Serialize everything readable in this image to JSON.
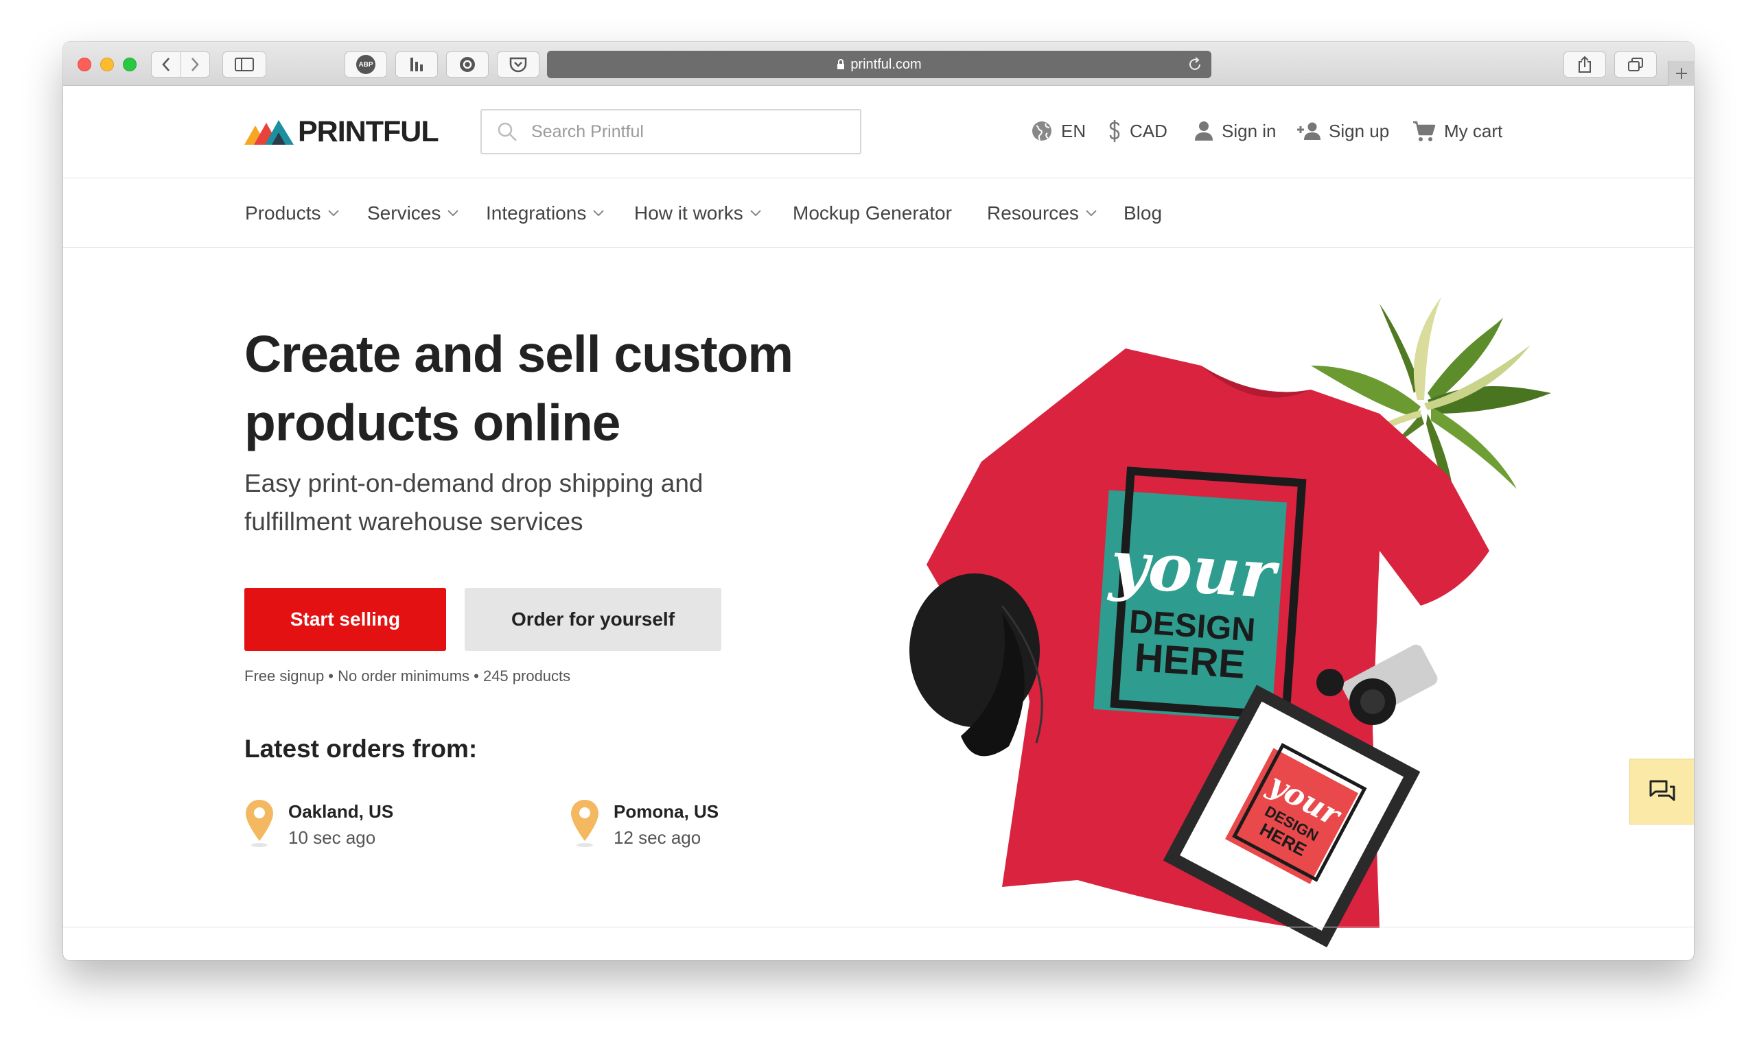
{
  "browser": {
    "url": "printful.com",
    "ext_abp_label": "ABP"
  },
  "header": {
    "logo_text": "PRINTFUL",
    "search_placeholder": "Search Printful",
    "language": "EN",
    "currency": "CAD",
    "sign_in": "Sign in",
    "sign_up": "Sign up",
    "cart": "My cart"
  },
  "nav": {
    "items": [
      {
        "label": "Products",
        "dropdown": true
      },
      {
        "label": "Services",
        "dropdown": true
      },
      {
        "label": "Integrations",
        "dropdown": true
      },
      {
        "label": "How it works",
        "dropdown": true
      },
      {
        "label": "Mockup Generator",
        "dropdown": false
      },
      {
        "label": "Resources",
        "dropdown": true
      },
      {
        "label": "Blog",
        "dropdown": false
      }
    ]
  },
  "hero": {
    "title_line1": "Create and sell custom",
    "title_line2": "products online",
    "subtitle_line1": "Easy print-on-demand drop shipping and",
    "subtitle_line2": "fulfillment warehouse services",
    "primary_button": "Start selling",
    "secondary_button": "Order for yourself",
    "perks": "Free signup • No order minimums • 245 products"
  },
  "latest_orders": {
    "title": "Latest orders from:",
    "orders": [
      {
        "city": "Oakland, US",
        "time": "10 sec ago"
      },
      {
        "city": "Pomona, US",
        "time": "12 sec ago"
      }
    ]
  },
  "hero_image": {
    "shirt_text_script": "your",
    "shirt_text_line1": "DESIGN",
    "shirt_text_line2": "HERE",
    "frame_text_script": "your",
    "frame_text_line1": "DESIGN",
    "frame_text_line2": "HERE"
  },
  "colors": {
    "brand_red": "#e31111",
    "secondary_gray": "#e5e5e5",
    "pin": "#f4b860",
    "shirt": "#d9233f",
    "teal": "#2e9c8e",
    "chat_bg": "#fbe9a8"
  },
  "icons": {
    "globe": "globe-icon",
    "dollar": "dollar-icon",
    "user": "user-icon",
    "add_user": "add-user-icon",
    "cart": "cart-icon",
    "search": "search-icon",
    "chevron": "chevron-down-icon",
    "pin": "map-pin-icon",
    "chat": "chat-icon"
  }
}
